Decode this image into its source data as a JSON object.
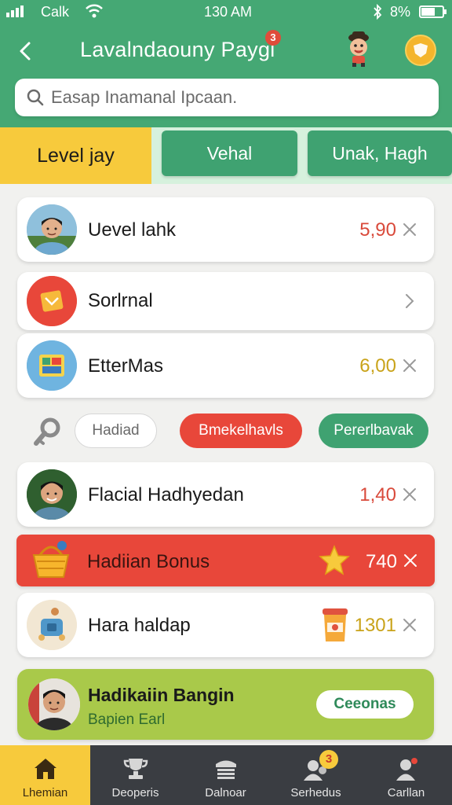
{
  "status": {
    "carrier": "Calk",
    "time": "130 AM",
    "battery": "8%"
  },
  "header": {
    "title": "Lavalndaouny Paygi",
    "title_badge": "3"
  },
  "search": {
    "placeholder": "Easap Inamanal Ipcaan."
  },
  "tabs": {
    "active": "Level  jay",
    "second": "Vehal",
    "third": "Unak, Hagh"
  },
  "rows": [
    {
      "label": "Uevel lahk",
      "value": "5,90"
    },
    {
      "label": "Sorlrnal"
    },
    {
      "label": "EtterMas",
      "value": "6,00"
    }
  ],
  "chips": {
    "first": "Hadiad",
    "second": "Bmekelhavls",
    "third": "Pererlbavak"
  },
  "rows2": [
    {
      "label": "Flacial Hadhyedan",
      "value": "1,40"
    },
    {
      "label": "Hadiian Bonus",
      "value": "740"
    },
    {
      "label": "Hara haldap",
      "value": "1301"
    }
  ],
  "promo": {
    "title": "Hadikaiin Bangin",
    "subtitle": "Bapien Earl",
    "button": "Ceeonas"
  },
  "nav": {
    "items": [
      {
        "label": "Lhemian"
      },
      {
        "label": "Deoperis"
      },
      {
        "label": "Dalnoar"
      },
      {
        "label": "Serhedus",
        "badge": "3"
      },
      {
        "label": "Carllan"
      }
    ]
  },
  "colors": {
    "header_green": "#45a874",
    "accent_yellow": "#f7ca3c",
    "red": "#e8473a",
    "value_red": "#d94a3b",
    "value_gold": "#c9a31a",
    "promo_green": "#a9c94a"
  }
}
